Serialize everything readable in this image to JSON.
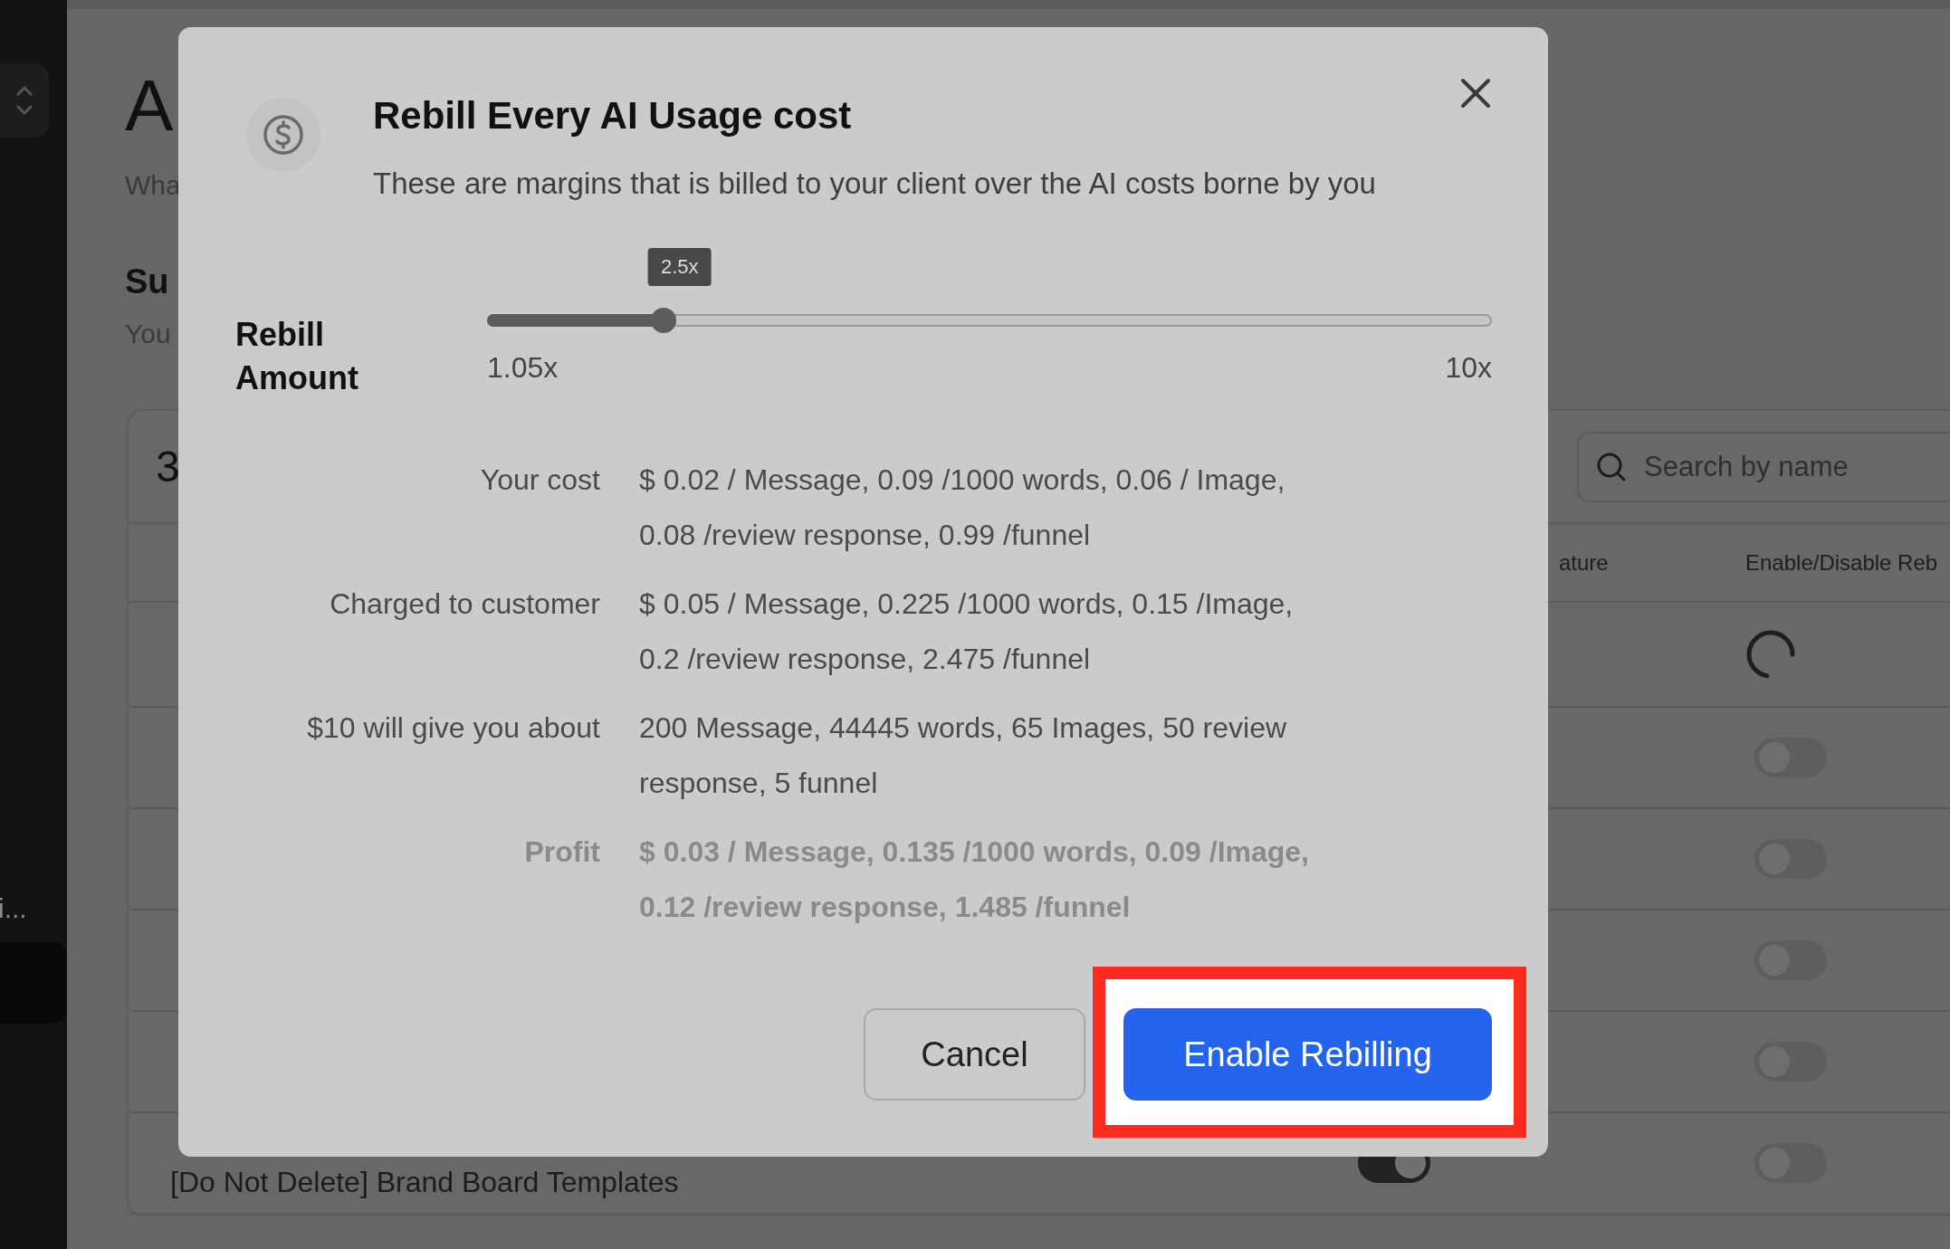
{
  "sidebar": {
    "item_label": "i..."
  },
  "page": {
    "title": "A",
    "subtitle": "Wha",
    "section_title": "Su",
    "section_text": "You"
  },
  "table": {
    "count": "3",
    "search": {
      "placeholder": "Search by name"
    },
    "columns": [
      "ature",
      "Enable/Disable Reb"
    ],
    "rows": [
      {
        "rebill": {
          "kind": "spinner"
        }
      },
      {
        "rebill": {
          "kind": "toggle",
          "on": false
        }
      },
      {
        "rebill": {
          "kind": "toggle",
          "on": false
        }
      },
      {
        "rebill": {
          "kind": "toggle",
          "on": false
        }
      },
      {
        "rebill": {
          "kind": "toggle",
          "on": false
        }
      },
      {
        "name": "[Do Not Delete] Brand Board Templates",
        "feature": {
          "on": true
        },
        "rebill": {
          "kind": "toggle",
          "on": false
        }
      }
    ]
  },
  "modal": {
    "title": "Rebill Every AI Usage cost",
    "description": "These are margins that is billed to your client over the AI costs borne by you",
    "slider": {
      "label": "Rebill Amount",
      "level": 0.176,
      "value_label": "2.5x",
      "min_label": "1.05x",
      "max_label": "10x"
    },
    "details": [
      {
        "label": "Your cost",
        "value": "$ 0.02 / Message, 0.09 /1000 words, 0.06 / Image, 0.08 /review response, 0.99 /funnel",
        "kind": "plain"
      },
      {
        "label": "Charged to customer",
        "value": "$ 0.05 / Message, 0.225 /1000 words, 0.15 /Image, 0.2 /review response, 2.475 /funnel",
        "kind": "plain"
      },
      {
        "label": "$10 will give you about",
        "value": "200 Message, 44445 words, 65 Images, 50 review response, 5 funnel",
        "kind": "plain"
      },
      {
        "label": "Profit",
        "value": "$ 0.03 / Message, 0.135 /1000 words, 0.09 /Image, 0.12 /review response, 1.485 /funnel",
        "kind": "profit"
      }
    ],
    "buttons": [
      {
        "label": "Cancel",
        "kind": "secondary",
        "highlighted": false
      },
      {
        "label": "Enable Rebilling",
        "kind": "primary",
        "highlighted": true
      }
    ]
  }
}
